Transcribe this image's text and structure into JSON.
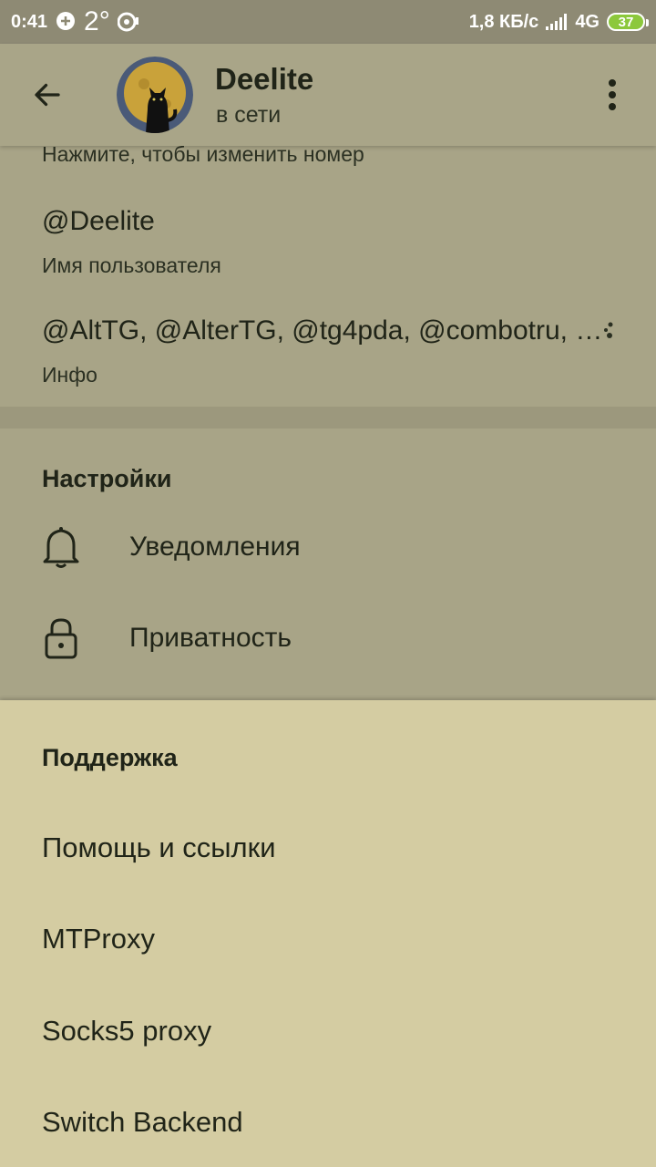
{
  "status_bar": {
    "time": "0:41",
    "temperature": "2°",
    "speed": "1,8 КБ/с",
    "network": "4G",
    "battery": "37"
  },
  "header": {
    "title": "Deelite",
    "subtitle": "в сети"
  },
  "profile": {
    "phone_hint": "Нажмите, чтобы изменить номер",
    "username_value": "@Deelite",
    "username_label": "Имя пользователя",
    "bio_value": "@AltTG, @AlterTG, @tg4pda, @combotru, …",
    "bio_label": "Инфо"
  },
  "settings": {
    "header": "Настройки",
    "items": [
      {
        "label": "Уведомления",
        "icon": "bell-icon"
      },
      {
        "label": "Приватность",
        "icon": "lock-icon"
      }
    ]
  },
  "support_sheet": {
    "header": "Поддержка",
    "items": [
      {
        "label": "Помощь и ссылки"
      },
      {
        "label": "MTProxy"
      },
      {
        "label": "Socks5 proxy"
      },
      {
        "label": "Switch Backend"
      }
    ]
  },
  "colors": {
    "sheet_background": "#d4cca2",
    "dimmed_background": "#a8a487",
    "status_bar": "#8e8a74",
    "text": "#202418"
  }
}
